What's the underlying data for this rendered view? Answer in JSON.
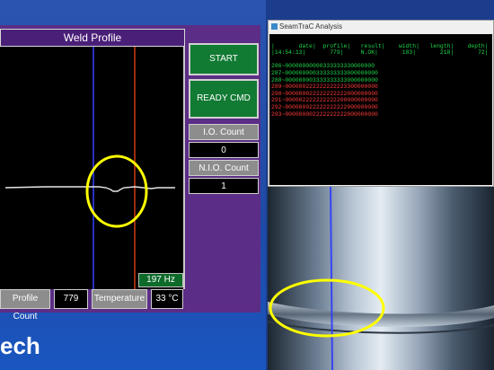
{
  "hmi": {
    "plot_title": "Weld Profile",
    "frequency": "197 Hz",
    "start_label": "START",
    "ready_label": "READY CMD",
    "io_label": "I.O. Count",
    "io_value": "0",
    "nio_label": "N.I.O. Count",
    "nio_value": "1",
    "profile_count_label": "Profile Count",
    "profile_count_value": "779",
    "temperature_label": "Temperature",
    "temperature_value": "33 °C"
  },
  "brand": {
    "text": "ech"
  },
  "analysis": {
    "window_title": "SeamTraC Analysis",
    "header_line1": "|       date|  profile|   result|    width|   length|    depth|",
    "header_line2": "|14:54:13|       779|     N.OK|       183|       218|       72|",
    "rows": [
      "286~00000000000333333330000000",
      "287~000000000333333333000000000",
      "288~000000003333333333000000000",
      "289~000000222222222223300000000",
      "290~000000022222222222000000000",
      "291~000002222222222200000000000",
      "292~000000022222222222000000000",
      "293~000000002222222222000000000"
    ]
  },
  "colors": {
    "ok_green": "#20d64a",
    "nok_red": "#ff3b3b",
    "highlight_yellow": "#ffff00"
  }
}
